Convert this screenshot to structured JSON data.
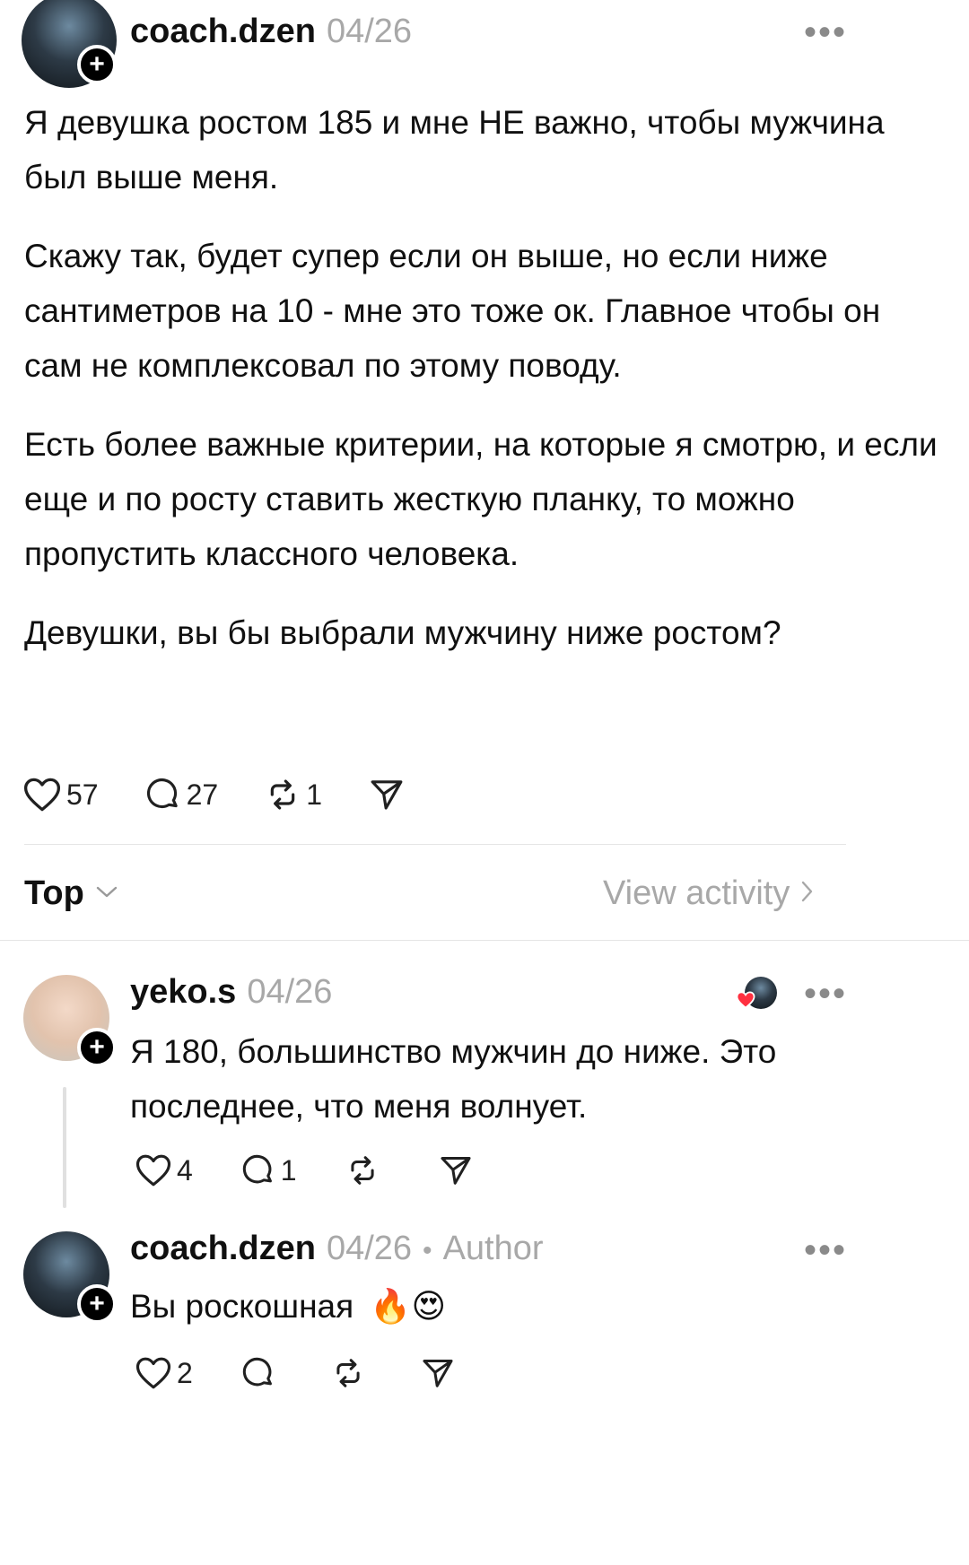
{
  "post": {
    "username": "coach.dzen",
    "date": "04/26",
    "paragraphs": [
      "Я девушка ростом 185 и мне НЕ важно, чтобы мужчина был выше меня.",
      "Скажу так, будет супер если он выше, но если ниже сантиметров на 10 - мне это тоже ок. Главное чтобы он сам не комплексовал по этому поводу.",
      "Есть более важные критерии, на которые я смотрю, и если еще и по росту ставить жесткую планку, то можно пропустить классного человека.",
      "Девушки, вы бы выбрали мужчину ниже ростом?"
    ],
    "likes": "57",
    "replies": "27",
    "reposts": "1"
  },
  "sort": {
    "label": "Top",
    "activity_label": "View activity"
  },
  "comments": [
    {
      "username": "yeko.s",
      "date": "04/26",
      "text": "Я 180, большинство мужчин до ниже. Это последнее, что меня волнует.",
      "likes": "4",
      "replies": "1"
    },
    {
      "username": "coach.dzen",
      "date": "04/26",
      "tag": "Author",
      "separator": "•",
      "text": "Вы роскошная",
      "emoji": "🔥😍",
      "likes": "2"
    }
  ],
  "icons": [
    "heart-icon",
    "comment-icon",
    "repost-icon",
    "share-icon",
    "more-icon",
    "plus-icon",
    "chevron-down-icon",
    "chevron-right-icon"
  ]
}
